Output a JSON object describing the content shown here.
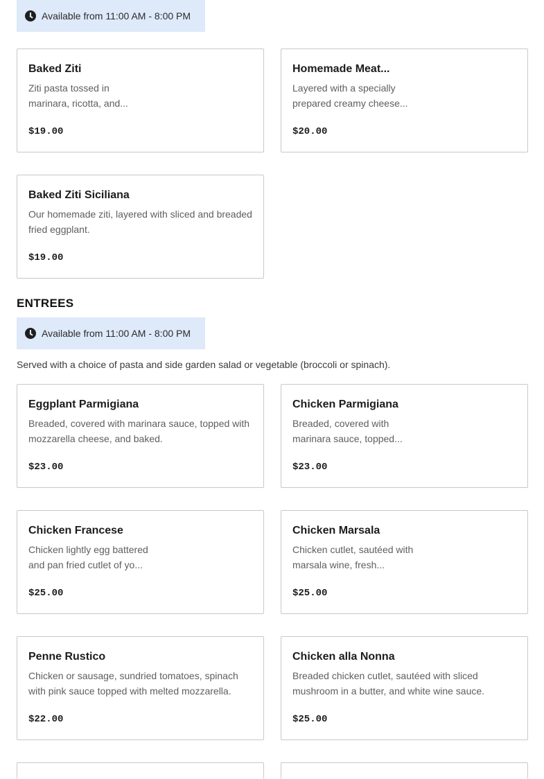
{
  "top_availability": {
    "icon": "clock-icon",
    "text": "Available from 11:00 AM - 8:00 PM"
  },
  "baked": {
    "items": [
      {
        "name": "Baked Ziti",
        "desc": "Ziti pasta tossed in marinara, ricotta, and...",
        "price": "$19.00"
      },
      {
        "name": "Homemade Meat...",
        "desc": "Layered with a specially prepared creamy cheese...",
        "price": "$20.00"
      },
      {
        "name": "Baked Ziti Siciliana",
        "desc": "Our homemade ziti, layered with sliced and breaded fried eggplant.",
        "price": "$19.00"
      }
    ]
  },
  "entrees": {
    "title": "ENTREES",
    "availability": "Available from 11:00 AM - 8:00 PM",
    "note": "Served with a choice of pasta and side garden salad or vegetable (broccoli or spinach).",
    "items": [
      {
        "name": "Eggplant Parmigiana",
        "desc": "Breaded, covered with marinara sauce, topped with mozzarella cheese, and baked.",
        "price": "$23.00"
      },
      {
        "name": "Chicken Parmigiana",
        "desc": "Breaded, covered with marinara sauce, topped...",
        "price": "$23.00"
      },
      {
        "name": "Chicken Francese",
        "desc": "Chicken lightly egg battered and pan fried cutlet of yo...",
        "price": "$25.00"
      },
      {
        "name": "Chicken Marsala",
        "desc": "Chicken cutlet, sautéed with marsala wine, fresh...",
        "price": "$25.00"
      },
      {
        "name": "Penne Rustico",
        "desc": "Chicken or sausage, sundried tomatoes, spinach with pink sauce topped with melted mozzarella.",
        "price": "$22.00"
      },
      {
        "name": "Chicken alla Nonna",
        "desc": "Breaded chicken cutlet, sautéed with sliced mushroom in a butter, and white wine sauce.",
        "price": "$25.00"
      }
    ]
  },
  "colors": {
    "availability_bg": "#dee9fa",
    "card_border": "#c8c8c8",
    "desc_text": "#5e5e5e"
  }
}
